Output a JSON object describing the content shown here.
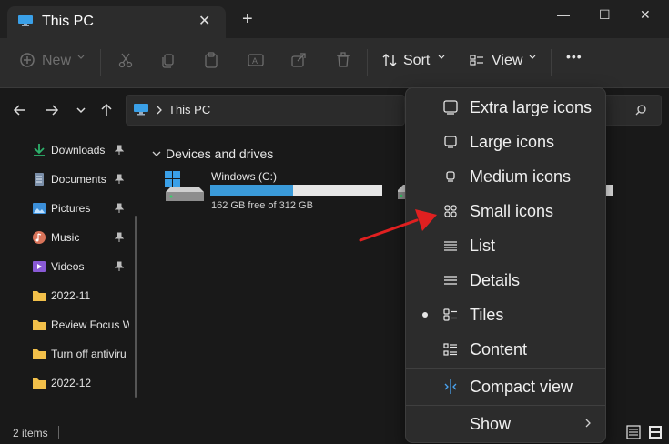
{
  "window": {
    "tab_title": "This PC",
    "close_tab": "✕",
    "new_tab": "+",
    "minimize": "—",
    "maximize": "☐",
    "close": "✕"
  },
  "toolbar": {
    "new_label": "New",
    "sort_label": "Sort",
    "view_label": "View",
    "more_label": "•••"
  },
  "address": {
    "path": "This PC"
  },
  "sidebar": {
    "items": [
      {
        "label": "Downloads",
        "icon": "download-icon",
        "pinned": true
      },
      {
        "label": "Documents",
        "icon": "document-icon",
        "pinned": true
      },
      {
        "label": "Pictures",
        "icon": "pictures-icon",
        "pinned": true
      },
      {
        "label": "Music",
        "icon": "music-icon",
        "pinned": true
      },
      {
        "label": "Videos",
        "icon": "videos-icon",
        "pinned": true
      },
      {
        "label": "2022-11",
        "icon": "folder-icon",
        "pinned": false
      },
      {
        "label": "Review Focus W",
        "icon": "folder-icon",
        "pinned": false
      },
      {
        "label": "Turn off antiviru",
        "icon": "folder-icon",
        "pinned": false
      },
      {
        "label": "2022-12",
        "icon": "folder-icon",
        "pinned": false
      }
    ]
  },
  "content": {
    "section_title": "Devices and drives",
    "drives": [
      {
        "name": "Windows (C:)",
        "free_text": "162 GB free of 312 GB",
        "used_fraction": 0.48
      }
    ]
  },
  "status": {
    "items_count": "2 items"
  },
  "view_menu": {
    "items": [
      {
        "label": "Extra large icons",
        "icon": "extra-large-icons-icon"
      },
      {
        "label": "Large icons",
        "icon": "large-icons-icon"
      },
      {
        "label": "Medium icons",
        "icon": "medium-icons-icon"
      },
      {
        "label": "Small icons",
        "icon": "small-icons-icon"
      },
      {
        "label": "List",
        "icon": "list-icon"
      },
      {
        "label": "Details",
        "icon": "details-icon"
      },
      {
        "label": "Tiles",
        "icon": "tiles-icon",
        "selected": true
      },
      {
        "label": "Content",
        "icon": "content-icon"
      },
      {
        "label": "Compact view",
        "icon": "compact-view-icon"
      },
      {
        "label": "Show",
        "icon": "",
        "has_submenu": true
      }
    ]
  },
  "colors": {
    "accent": "#3a9ad9",
    "annotation_arrow": "#e02020"
  }
}
